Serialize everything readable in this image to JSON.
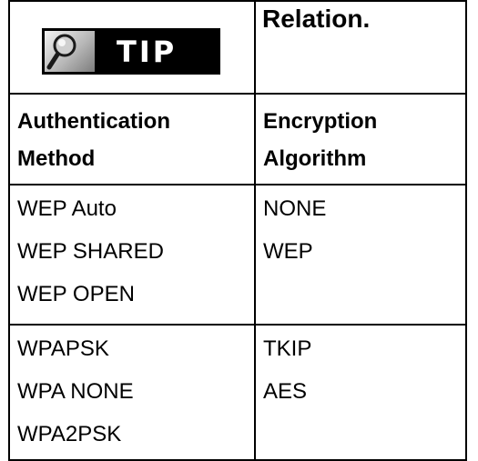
{
  "tip": {
    "badge_label": "TIP",
    "icon": "magnifier-icon"
  },
  "relation": {
    "title": "Relation."
  },
  "columns": {
    "left_header": [
      "Authentication",
      "Method"
    ],
    "right_header": [
      "Encryption",
      "Algorithm"
    ]
  },
  "groups": [
    {
      "methods": [
        "WEP Auto",
        "WEP SHARED",
        "WEP OPEN"
      ],
      "algorithms": [
        "NONE",
        "WEP"
      ]
    },
    {
      "methods": [
        "WPAPSK",
        "WPA NONE",
        "WPA2PSK"
      ],
      "algorithms": [
        "TKIP",
        "AES"
      ]
    }
  ],
  "colors": {
    "border": "#000000",
    "badge_background": "#000000",
    "badge_text": "#ffffff"
  }
}
